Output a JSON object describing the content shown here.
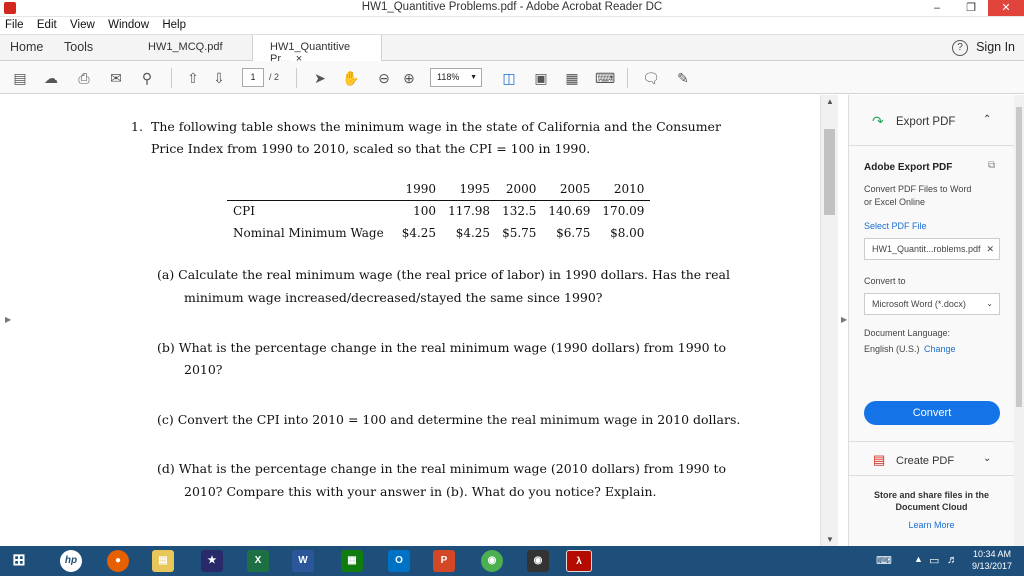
{
  "window": {
    "title": "HW1_Quantitive Problems.pdf - Adobe Acrobat Reader DC",
    "minimize": "–",
    "restore": "❐",
    "close": "✕"
  },
  "menu": [
    "File",
    "Edit",
    "View",
    "Window",
    "Help"
  ],
  "tabs": {
    "home": "Home",
    "tools": "Tools",
    "doc1": "HW1_MCQ.pdf",
    "doc2": "HW1_Quantitive Pr...",
    "doc2_close": "×",
    "help": "?",
    "signin": "Sign In"
  },
  "toolbar": {
    "page_current": "1",
    "page_total": "/ 2",
    "zoom": "118%"
  },
  "document": {
    "q1_number": "1.",
    "q1_line1": "The following table shows the minimum wage in the state of California and the Consumer",
    "q1_line2": "Price Index from 1990 to 2010, scaled so that the CPI = 100 in 1990.",
    "table": {
      "years": [
        "1990",
        "1995",
        "2000",
        "2005",
        "2010"
      ],
      "rows": [
        {
          "label": "CPI",
          "values": [
            "100",
            "117.98",
            "132.5",
            "140.69",
            "170.09"
          ]
        },
        {
          "label": "Nominal Minimum Wage",
          "values": [
            "$4.25",
            "$4.25",
            "$5.75",
            "$6.75",
            "$8.00"
          ]
        }
      ]
    },
    "a_line1": "(a)  Calculate the real minimum wage (the real price of labor) in 1990 dollars.  Has the real",
    "a_line2": "minimum wage increased/decreased/stayed the same since 1990?",
    "b_line1": "(b)  What is the percentage change in the real minimum wage (1990 dollars) from 1990 to",
    "b_line2": "2010?",
    "c_line1": "(c)  Convert the CPI into 2010 = 100 and determine the real minimum wage in 2010 dollars.",
    "d_line1": "(d)  What is the percentage change in the real minimum wage (2010 dollars) from 1990 to",
    "d_line2": "2010?  Compare this with your answer in (b).  What do you notice?  Explain."
  },
  "right_panel": {
    "export_title": "Export PDF",
    "section_title": "Adobe Export PDF",
    "desc1": "Convert PDF Files to Word",
    "desc2": "or Excel Online",
    "select_label": "Select PDF File",
    "file_name": "HW1_Quantit...roblems.pdf",
    "file_clear": "✕",
    "convert_to_label": "Convert to",
    "format": "Microsoft Word (*.docx)",
    "lang_label": "Document Language:",
    "lang_value": "English (U.S.)",
    "lang_change": "Change",
    "convert_button": "Convert",
    "create_pdf": "Create PDF",
    "cloud_line1": "Store and share files in the",
    "cloud_line2": "Document Cloud",
    "learn_more": "Learn More"
  },
  "taskbar": {
    "time": "10:34 AM",
    "date": "9/13/2017"
  }
}
